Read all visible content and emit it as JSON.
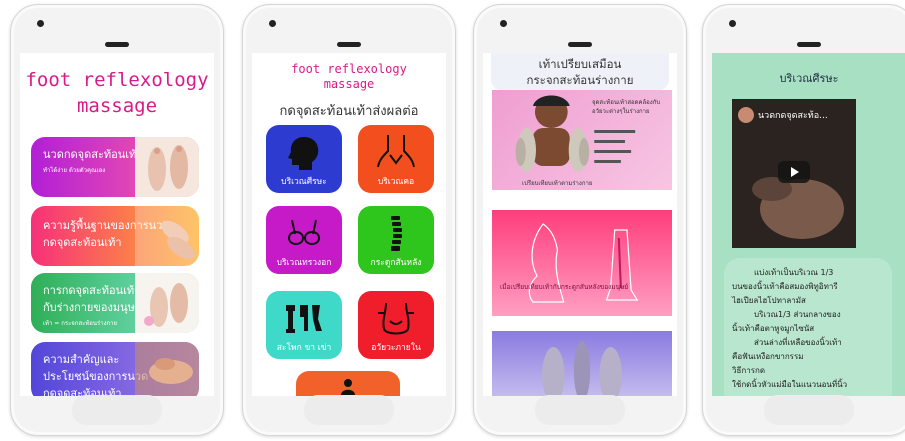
{
  "phone1": {
    "title_line1": "foot reflexology",
    "title_line2": "massage",
    "cards": [
      {
        "title": "นวดกดจุดสะท้อนเท้า",
        "subtitle": "ทำได้ง่าย ด้วยตัวคุณเอง",
        "small": ""
      },
      {
        "title": "ความรู้พื้นฐานของการนวดกดจุดสะท้อนเท้า",
        "subtitle": "",
        "small": ""
      },
      {
        "title": "การกดจุดสะท้อนเท้ากับร่างกายของมนุษย์",
        "subtitle": "",
        "small": "เท้า = กระจกสะท้อนร่างกาย"
      },
      {
        "title": "ความสำคัญและประโยชน์ของการนวดกดจุดสะท้อนเท้า",
        "subtitle": "",
        "small": ""
      }
    ]
  },
  "phone2": {
    "title_line1": "foot reflexology",
    "title_line2": "massage",
    "subtitle": "กดจุดสะท้อนเท้าส่งผลต่อ",
    "tiles": [
      {
        "label": "บริเวณศีรษะ",
        "color": "#2d3bd1",
        "icon": "head-icon"
      },
      {
        "label": "บริเวณคอ",
        "color": "#f24e1e",
        "icon": "neck-icon"
      },
      {
        "label": "บริเวณทรวงอก",
        "color": "#c61ac9",
        "icon": "chest-icon"
      },
      {
        "label": "กระดูกสันหลัง",
        "color": "#2ec51c",
        "icon": "spine-icon"
      },
      {
        "label": "สะโพก ขา เข่า",
        "color": "#3fd9c9",
        "icon": "hip-leg-icon"
      },
      {
        "label": "อวัยวะภายใน",
        "color": "#f01e2a",
        "icon": "organs-icon"
      }
    ]
  },
  "phone3": {
    "header_line1": "เท้าเปรียบเสมือน",
    "header_line2": "กระจกสะท้อนร่างกาย",
    "image1_caption": "เปรียบเทียบเท้าตามร่างกาย",
    "image1_side": "จุดสะท้อนเท้าสอดคล้องกับอวัยวะต่างๆในร่างกาย",
    "image2_caption": "เมื่อเปรียบเทียบเท้ากับกระดูกสันหลังของมนุษย์"
  },
  "phone4": {
    "header": "บริเวณศีรษะ",
    "video_title": "นวดกดจุดสะท้อ...",
    "body": [
      "แบ่งเท้าเป็นบริเวณ 1/3",
      "บนของนิ้วเท้าคือสมองพิทูอิทารี",
      "ไฮเปียลไฮโปทาลามัส",
      "บริเวณ1/3 ส่วนกลางของ",
      "นิ้วเท้าคือตาหูจมูกไซนัส",
      "ส่วนล่างที่เหลือของนิ้วเท้า",
      "คือฟันเหงือกขากรรม",
      "วิธีการกด",
      "ใช้กดนิ้วหัวแม่มือในแนวนอนที่นิ้ว"
    ]
  }
}
